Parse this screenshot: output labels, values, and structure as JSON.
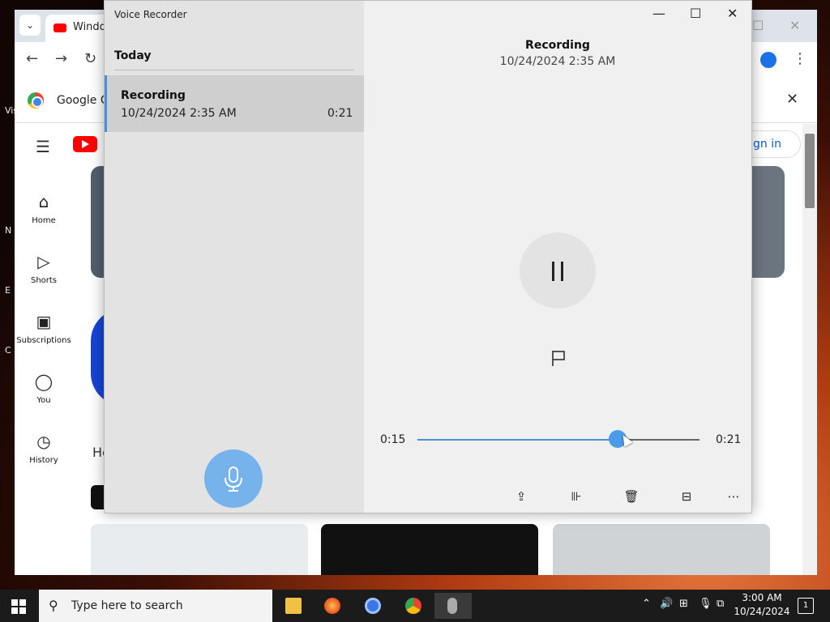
{
  "desktop": {
    "icons": [
      {
        "label": "Vis"
      },
      {
        "label": ""
      },
      {
        "label": "N"
      },
      {
        "label": "E"
      },
      {
        "label": "C"
      },
      {
        "label": ""
      }
    ]
  },
  "browser": {
    "tab_title": "Windo",
    "infobar_text": "Google Ch",
    "youtube": {
      "sidebar": [
        {
          "label": "Home",
          "icon": "home-icon"
        },
        {
          "label": "Shorts",
          "icon": "shorts-icon"
        },
        {
          "label": "Subscriptions",
          "icon": "subscriptions-icon"
        },
        {
          "label": "You",
          "icon": "you-icon"
        },
        {
          "label": "History",
          "icon": "history-icon"
        }
      ],
      "signin_label": "gn in",
      "partial_heading": "He"
    }
  },
  "voice_recorder": {
    "app_title": "Voice Recorder",
    "section": "Today",
    "recordings": [
      {
        "name": "Recording",
        "date": "10/24/2024 2:35 AM",
        "duration": "0:21"
      }
    ],
    "current": {
      "title": "Recording",
      "date": "10/24/2024 2:35 AM",
      "position": "0:15",
      "length": "0:21",
      "progress_fraction": 0.71
    }
  },
  "taskbar": {
    "search_placeholder": "Type here to search",
    "time": "3:00 AM",
    "date": "10/24/2024",
    "notification_count": "1"
  },
  "colors": {
    "accent": "#4a9be8",
    "mic_button": "#76b3ec",
    "taskbar": "#1b1b1b"
  }
}
